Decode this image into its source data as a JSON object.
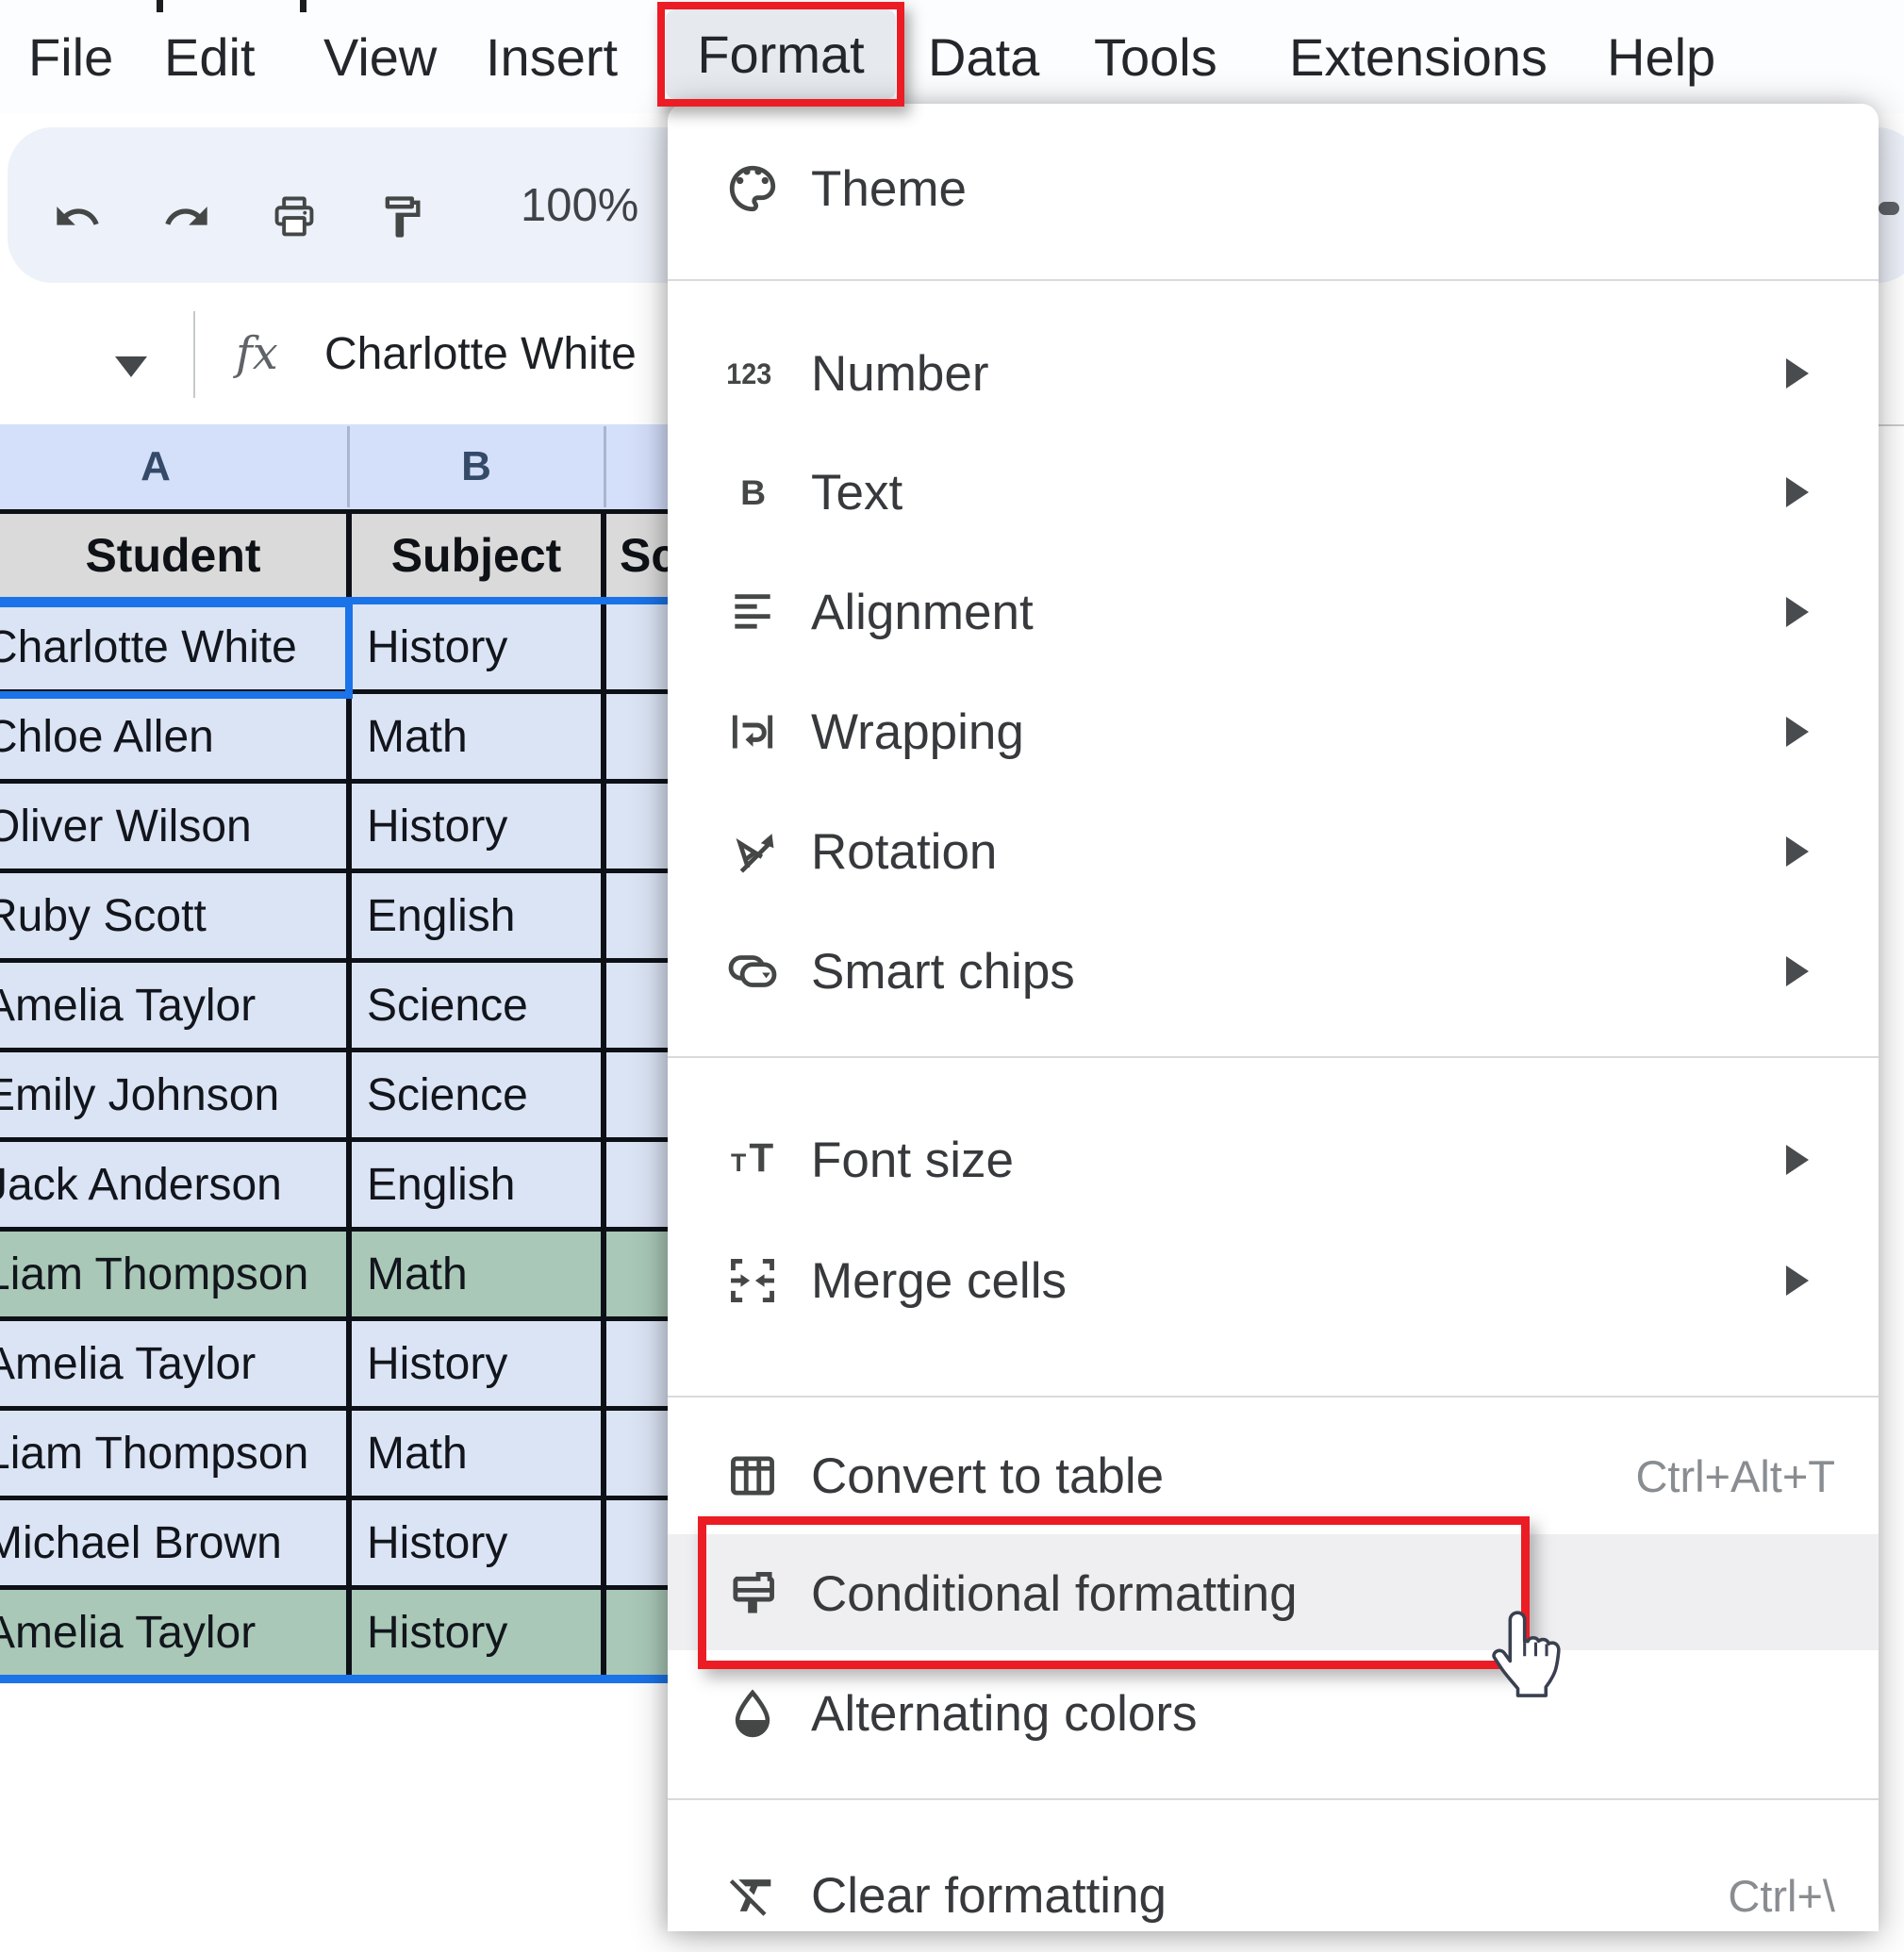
{
  "menu_bar": {
    "items": [
      "File",
      "Edit",
      "View",
      "Insert",
      "Format",
      "Data",
      "Tools",
      "Extensions",
      "Help"
    ],
    "active_item": "Format"
  },
  "toolbar": {
    "zoom_level": "100%",
    "icons": [
      "undo-icon",
      "redo-icon",
      "print-icon",
      "paint-format-icon"
    ]
  },
  "formula_bar": {
    "fx_label": "fx",
    "value": "Charlotte White"
  },
  "column_headers": [
    "A",
    "B"
  ],
  "table": {
    "headers": [
      "Student",
      "Subject",
      "Sc"
    ],
    "selected_cell_value": "Charlotte White",
    "rows": [
      {
        "student": "Charlotte White",
        "subject": "History",
        "highlighted": false,
        "selected": true
      },
      {
        "student": "Chloe Allen",
        "subject": "Math",
        "highlighted": false
      },
      {
        "student": "Oliver Wilson",
        "subject": "History",
        "highlighted": false
      },
      {
        "student": "Ruby Scott",
        "subject": "English",
        "highlighted": false
      },
      {
        "student": "Amelia Taylor",
        "subject": "Science",
        "highlighted": false
      },
      {
        "student": "Emily Johnson",
        "subject": "Science",
        "highlighted": false
      },
      {
        "student": "Jack Anderson",
        "subject": "English",
        "highlighted": false
      },
      {
        "student": "Liam Thompson",
        "subject": "Math",
        "highlighted": true
      },
      {
        "student": "Amelia Taylor",
        "subject": "History",
        "highlighted": false
      },
      {
        "student": "Liam Thompson",
        "subject": "Math",
        "highlighted": false
      },
      {
        "student": "Michael Brown",
        "subject": "History",
        "highlighted": false
      },
      {
        "student": "Amelia Taylor",
        "subject": "History",
        "highlighted": true
      }
    ]
  },
  "format_menu": {
    "items": [
      {
        "label": "Theme",
        "icon": "palette-icon"
      },
      {
        "label": "Number",
        "icon": "number-123-icon",
        "has_submenu": true
      },
      {
        "label": "Text",
        "icon": "bold-text-icon",
        "has_submenu": true
      },
      {
        "label": "Alignment",
        "icon": "alignment-icon",
        "has_submenu": true
      },
      {
        "label": "Wrapping",
        "icon": "wrapping-icon",
        "has_submenu": true
      },
      {
        "label": "Rotation",
        "icon": "rotation-icon",
        "has_submenu": true
      },
      {
        "label": "Smart chips",
        "icon": "smart-chips-icon",
        "has_submenu": true
      },
      {
        "label": "Font size",
        "icon": "font-size-icon",
        "has_submenu": true
      },
      {
        "label": "Merge cells",
        "icon": "merge-cells-icon",
        "has_submenu": true
      },
      {
        "label": "Convert to table",
        "icon": "table-icon",
        "shortcut": "Ctrl+Alt+T"
      },
      {
        "label": "Conditional formatting",
        "icon": "paint-brush-icon",
        "highlighted": true
      },
      {
        "label": "Alternating colors",
        "icon": "droplet-icon"
      },
      {
        "label": "Clear formatting",
        "icon": "clear-format-icon",
        "shortcut": "Ctrl+\\"
      }
    ]
  },
  "annotations": {
    "highlight_color": "#ec1c24",
    "boxed_elements": [
      "Format menu item",
      "Conditional formatting menu row"
    ],
    "cursor": "hand-pointer over Conditional formatting"
  },
  "colors": {
    "selection_blue": "#1a73e8",
    "cell_blue": "#dbe4f4",
    "highlight_green": "#a9c8b7",
    "table_header_gray": "#dadada",
    "column_strip_blue": "#d4dffa",
    "annotation_red": "#ec1c24"
  }
}
